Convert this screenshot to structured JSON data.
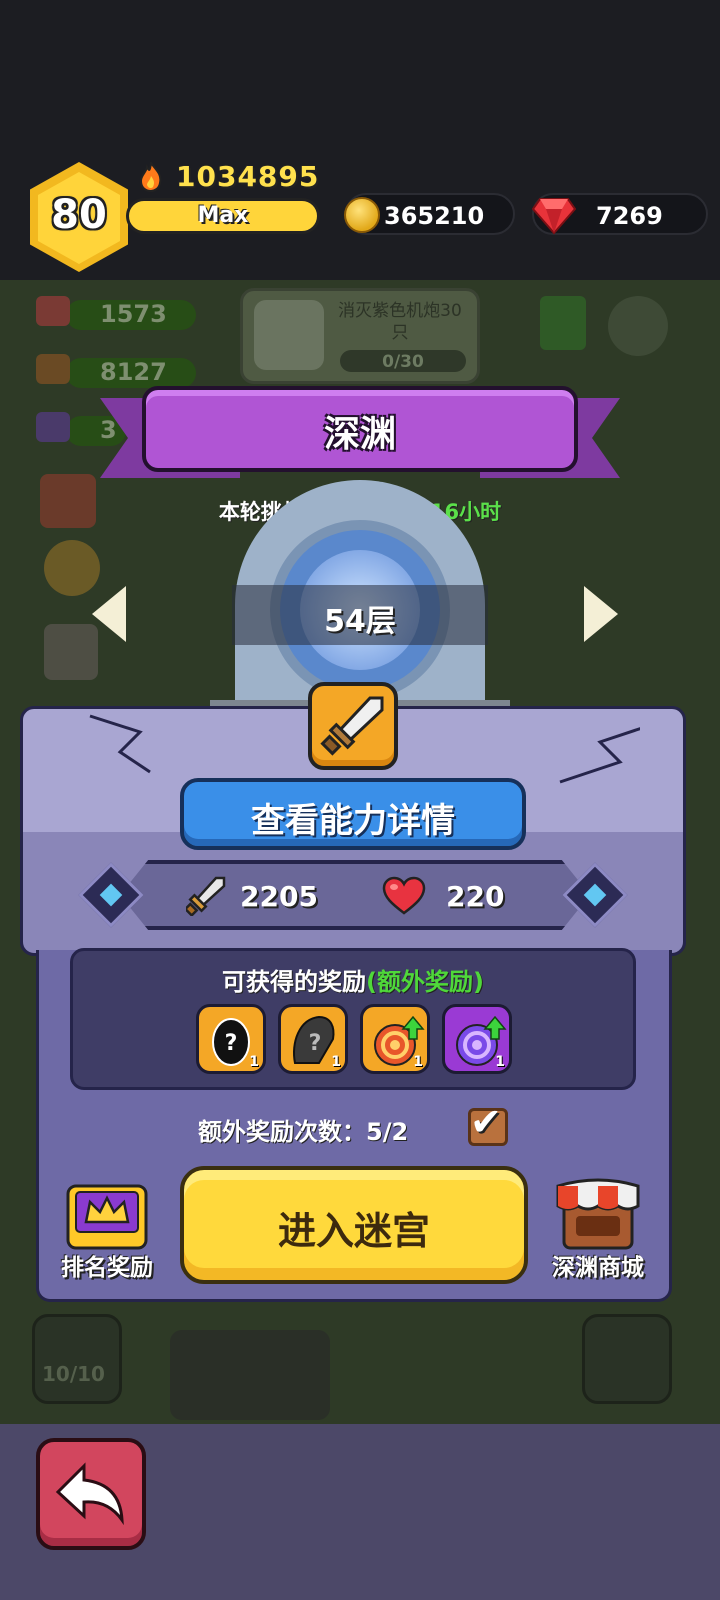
{
  "header": {
    "level": "80",
    "power": "1034895",
    "xp_label": "Max",
    "coins": "365210",
    "gems": "7269"
  },
  "background": {
    "resources": [
      "1573",
      "8127",
      "3"
    ],
    "quest_text": "消灭紫色机炮30只",
    "quest_progress": "0/30",
    "stamina": "10/10"
  },
  "abyss": {
    "title": "深渊",
    "timer_prefix": "本轮挑战剩余时间 ",
    "timer_value": "0天16小时",
    "floor": "54层",
    "detail_button": "查看能力详情",
    "attack": "2205",
    "hp": "220"
  },
  "rewards": {
    "title": "可获得的奖励",
    "extra": "(额外奖励)",
    "items": [
      {
        "name": "mystery-egg-black",
        "count": "1"
      },
      {
        "name": "mystery-egg-gray",
        "count": "1"
      },
      {
        "name": "orange-orb-upgrade",
        "count": "1"
      },
      {
        "name": "purple-orb-upgrade",
        "count": "1"
      }
    ],
    "bonus_count_text": "额外奖励次数：5/2"
  },
  "actions": {
    "enter": "进入迷宫",
    "ranking": "排名奖励",
    "shop": "深渊商城"
  },
  "colors": {
    "banner": "#b055d4",
    "button_blue": "#3a8fe8",
    "button_yellow": "#ffd93c",
    "timer_green": "#5be04a"
  }
}
